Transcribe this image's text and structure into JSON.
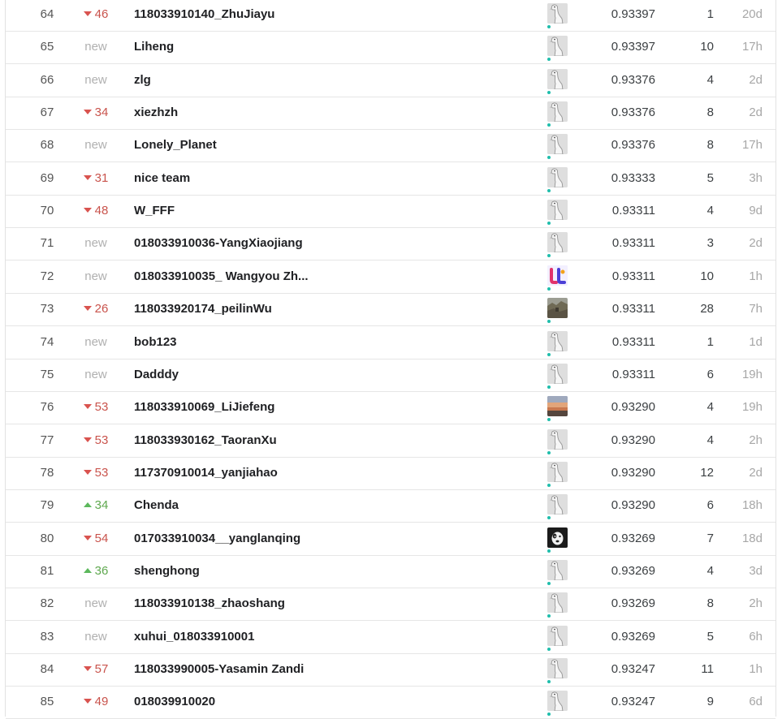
{
  "leaderboard": {
    "rows": [
      {
        "rank": "64",
        "change": {
          "type": "down",
          "value": "46"
        },
        "team": "118033910140_ZhuJiayu",
        "avatar": "goose",
        "score": "0.93397",
        "entries": "1",
        "last": "20d"
      },
      {
        "rank": "65",
        "change": {
          "type": "new",
          "value": "new"
        },
        "team": "Liheng",
        "avatar": "goose",
        "score": "0.93397",
        "entries": "10",
        "last": "17h"
      },
      {
        "rank": "66",
        "change": {
          "type": "new",
          "value": "new"
        },
        "team": "zlg",
        "avatar": "goose",
        "score": "0.93376",
        "entries": "4",
        "last": "2d"
      },
      {
        "rank": "67",
        "change": {
          "type": "down",
          "value": "34"
        },
        "team": "xiezhzh",
        "avatar": "goose",
        "score": "0.93376",
        "entries": "8",
        "last": "2d"
      },
      {
        "rank": "68",
        "change": {
          "type": "new",
          "value": "new"
        },
        "team": "Lonely_Planet",
        "avatar": "goose",
        "score": "0.93376",
        "entries": "8",
        "last": "17h"
      },
      {
        "rank": "69",
        "change": {
          "type": "down",
          "value": "31"
        },
        "team": "nice team",
        "avatar": "goose",
        "score": "0.93333",
        "entries": "5",
        "last": "3h"
      },
      {
        "rank": "70",
        "change": {
          "type": "down",
          "value": "48"
        },
        "team": "W_FFF",
        "avatar": "goose",
        "score": "0.93311",
        "entries": "4",
        "last": "9d"
      },
      {
        "rank": "71",
        "change": {
          "type": "new",
          "value": "new"
        },
        "team": "018033910036-YangXiaojiang",
        "avatar": "goose",
        "score": "0.93311",
        "entries": "3",
        "last": "2d"
      },
      {
        "rank": "72",
        "change": {
          "type": "new",
          "value": "new"
        },
        "team": "018033910035_ Wangyou Zh...",
        "avatar": "letters",
        "score": "0.93311",
        "entries": "10",
        "last": "1h"
      },
      {
        "rank": "73",
        "change": {
          "type": "down",
          "value": "26"
        },
        "team": "118033920174_peilinWu",
        "avatar": "landscape",
        "score": "0.93311",
        "entries": "28",
        "last": "7h"
      },
      {
        "rank": "74",
        "change": {
          "type": "new",
          "value": "new"
        },
        "team": "bob123",
        "avatar": "goose",
        "score": "0.93311",
        "entries": "1",
        "last": "1d"
      },
      {
        "rank": "75",
        "change": {
          "type": "new",
          "value": "new"
        },
        "team": "Dadddy",
        "avatar": "goose",
        "score": "0.93311",
        "entries": "6",
        "last": "19h"
      },
      {
        "rank": "76",
        "change": {
          "type": "down",
          "value": "53"
        },
        "team": "118033910069_LiJiefeng",
        "avatar": "sunset",
        "score": "0.93290",
        "entries": "4",
        "last": "19h"
      },
      {
        "rank": "77",
        "change": {
          "type": "down",
          "value": "53"
        },
        "team": "118033930162_TaoranXu",
        "avatar": "goose",
        "score": "0.93290",
        "entries": "4",
        "last": "2h"
      },
      {
        "rank": "78",
        "change": {
          "type": "down",
          "value": "53"
        },
        "team": "117370910014_yanjiahao",
        "avatar": "goose",
        "score": "0.93290",
        "entries": "12",
        "last": "2d"
      },
      {
        "rank": "79",
        "change": {
          "type": "up",
          "value": "34"
        },
        "team": "Chenda",
        "avatar": "goose",
        "score": "0.93290",
        "entries": "6",
        "last": "18h"
      },
      {
        "rank": "80",
        "change": {
          "type": "down",
          "value": "54"
        },
        "team": "017033910034__yanglanqing",
        "avatar": "dog",
        "score": "0.93269",
        "entries": "7",
        "last": "18d"
      },
      {
        "rank": "81",
        "change": {
          "type": "up",
          "value": "36"
        },
        "team": "shenghong",
        "avatar": "goose",
        "score": "0.93269",
        "entries": "4",
        "last": "3d"
      },
      {
        "rank": "82",
        "change": {
          "type": "new",
          "value": "new"
        },
        "team": "118033910138_zhaoshang",
        "avatar": "goose",
        "score": "0.93269",
        "entries": "8",
        "last": "2h"
      },
      {
        "rank": "83",
        "change": {
          "type": "new",
          "value": "new"
        },
        "team": "xuhui_018033910001",
        "avatar": "goose",
        "score": "0.93269",
        "entries": "5",
        "last": "6h"
      },
      {
        "rank": "84",
        "change": {
          "type": "down",
          "value": "57"
        },
        "team": "118033990005-Yasamin Zandi",
        "avatar": "goose",
        "score": "0.93247",
        "entries": "11",
        "last": "1h"
      },
      {
        "rank": "85",
        "change": {
          "type": "down",
          "value": "49"
        },
        "team": "018039910020",
        "avatar": "goose",
        "score": "0.93247",
        "entries": "9",
        "last": "6d"
      }
    ]
  },
  "colors": {
    "rank_down": "#c9534c",
    "rank_up": "#5fa84f",
    "rank_new": "#b0b0b0",
    "tier_dot": "#20beac",
    "row_border": "#e6e6e6"
  }
}
